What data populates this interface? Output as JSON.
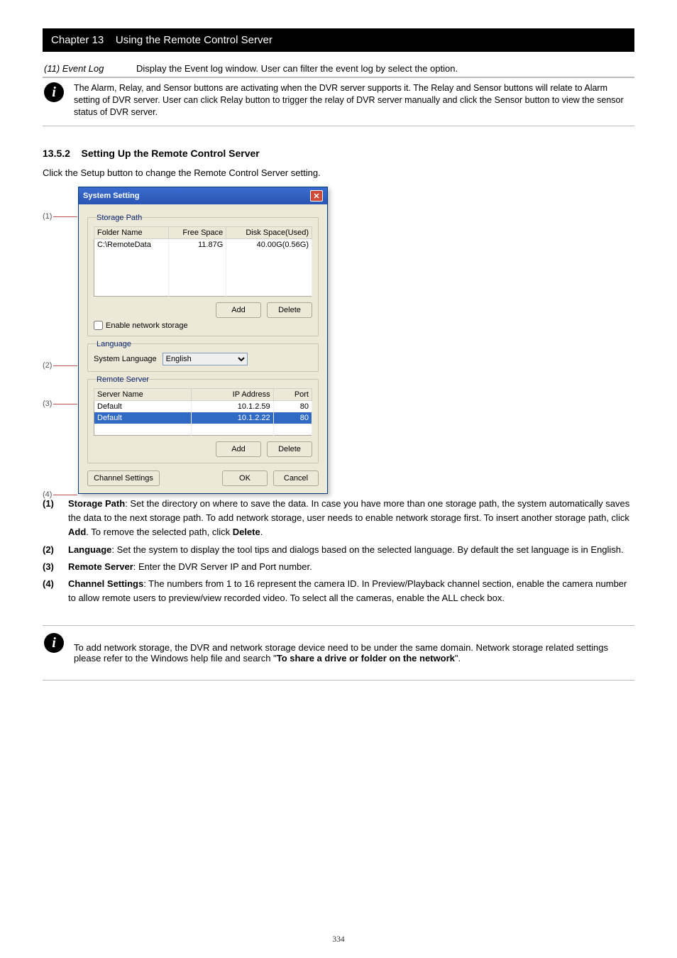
{
  "header": {
    "chapter": "Chapter 13",
    "title": "Using the Remote Control Server"
  },
  "topTable": {
    "rows": [
      {
        "l": "(11) Event Log",
        "r": "Display the Event log window. User can filter the event log by select the option."
      }
    ]
  },
  "note1": "The Alarm, Relay, and Sensor buttons are activating when the DVR server supports it. The Relay and Sensor buttons will relate to Alarm setting of DVR server. User can click Relay button to trigger the relay of DVR server manually and click the Sensor button to view the sensor status of DVR server.",
  "section": {
    "num": "13.5.2",
    "title": "Setting Up the Remote Control Server",
    "lead": "Click the Setup button to change the Remote Control Server setting."
  },
  "dialog": {
    "title": "System Setting",
    "storage": {
      "legend": "Storage Path",
      "cols": [
        "Folder Name",
        "Free Space",
        "Disk Space(Used)"
      ],
      "rows": [
        [
          "C:\\RemoteData",
          "11.87G",
          "40.00G(0.56G)"
        ]
      ],
      "addBtn": "Add",
      "delBtn": "Delete",
      "enableChk": "Enable network storage"
    },
    "language": {
      "legend": "Language",
      "label": "System Language",
      "value": "English"
    },
    "remote": {
      "legend": "Remote Server",
      "cols": [
        "Server Name",
        "IP Address",
        "Port"
      ],
      "rows": [
        {
          "name": "Default",
          "ip": "10.1.2.59",
          "port": "80",
          "sel": false
        },
        {
          "name": "Default",
          "ip": "10.1.2.22",
          "port": "80",
          "sel": true
        }
      ],
      "addBtn": "Add",
      "delBtn": "Delete"
    },
    "bottom": {
      "channel": "Channel Settings",
      "ok": "OK",
      "cancel": "Cancel"
    }
  },
  "callouts": [
    "(1)",
    "(2)",
    "(3)",
    "(4)"
  ],
  "desc": [
    {
      "n": "(1)",
      "b": "Storage Path",
      "t": ": Set the directory on where to save the data. In case you have more than one storage path, the system automatically saves the data to the next storage path. To add network storage, user needs to enable network storage first. To insert another storage path, click "
    },
    {
      "sub": "Add",
      "post": ". To remove the selected path, click ",
      "sub2": "Delete",
      "post2": "."
    },
    {
      "n": "(2)",
      "b": "Language",
      "t": ": Set the system to display the tool tips and dialogs based on the selected language. By default the set language is in English."
    },
    {
      "n": "(3)",
      "b": "Remote Server",
      "t": ": Enter the DVR Server IP and Port number."
    },
    {
      "n": "(4)",
      "b": "Channel Settings",
      "t": ": The numbers from 1 to 16 represent the camera ID. In Preview/Playback channel section, enable the camera number to allow remote users to preview/view recorded video. To select all the cameras, enable the ALL check box."
    }
  ],
  "note2": {
    "pre": "To add network storage, the DVR and network storage device need to be under the same domain. Network storage related settings please refer to the Windows ",
    "mid": "help file and search \"",
    "link": "To share a drive or folder on the network",
    "post": "\"."
  },
  "pageNumber": "334"
}
